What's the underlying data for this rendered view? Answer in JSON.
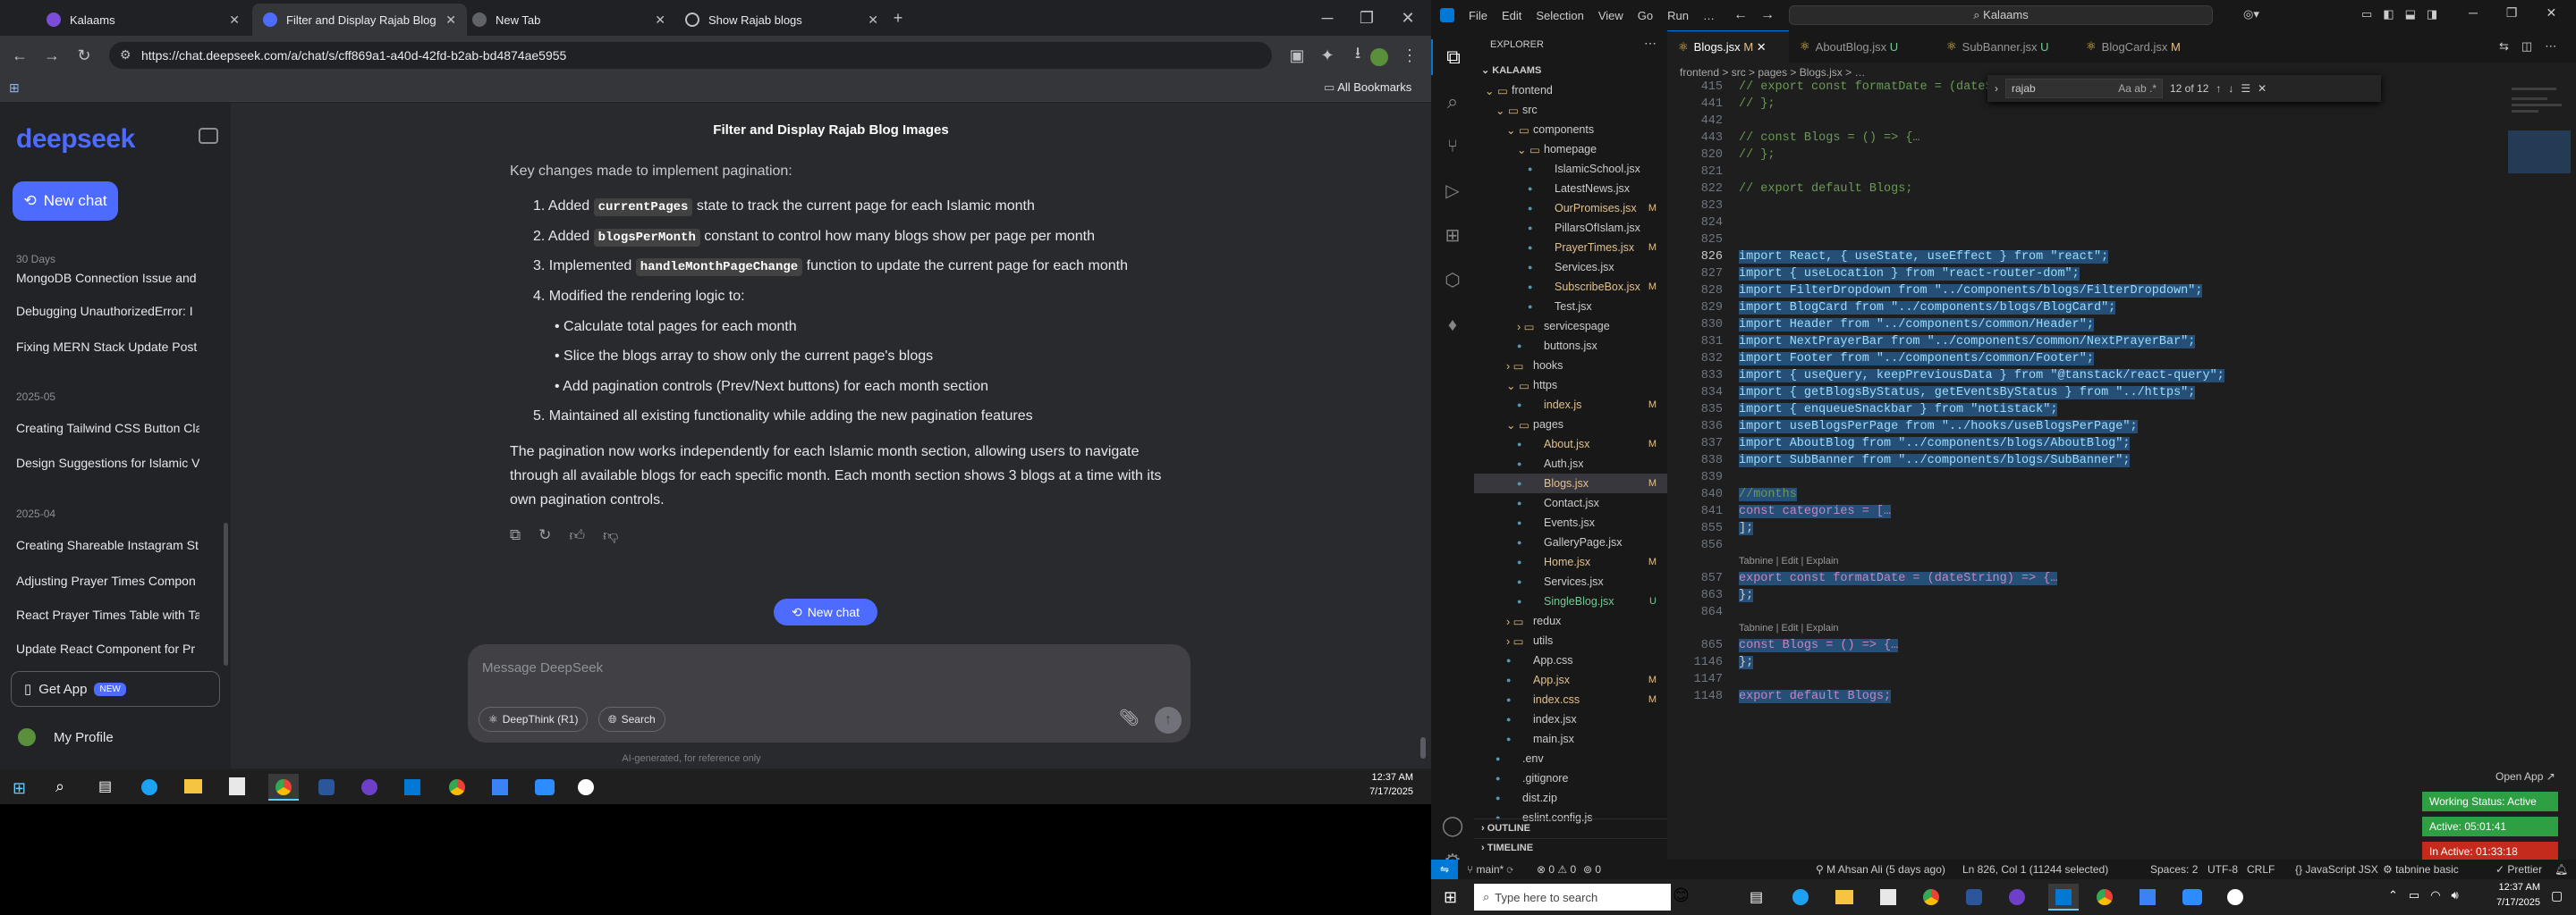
{
  "browser": {
    "tabs": [
      {
        "title": "Kalaams",
        "active": false
      },
      {
        "title": "Filter and Display Rajab Blog Im",
        "active": true
      },
      {
        "title": "New Tab",
        "active": false
      },
      {
        "title": "Show Rajab blogs",
        "active": false
      }
    ],
    "url": "https://chat.deepseek.com/a/chat/s/cff869a1-a40d-42fd-b2ab-bd4874ae5955",
    "all_bookmarks": "All Bookmarks"
  },
  "deepseek": {
    "logo": "deepseek",
    "new_chat": "New chat",
    "history_groups": [
      {
        "label": "30 Days",
        "items": [
          "MongoDB Connection Issue and",
          "Debugging UnauthorizedError: I",
          "Fixing MERN Stack Update Post I"
        ]
      },
      {
        "label": "2025-05",
        "items": [
          "Creating Tailwind CSS Button Cla",
          "Design Suggestions for Islamic V"
        ]
      },
      {
        "label": "2025-04",
        "items": [
          "Creating Shareable Instagram St",
          "Adjusting Prayer Times Compon",
          "React Prayer Times Table with Ta",
          "Update React Component for Pr"
        ]
      }
    ],
    "get_app": "Get App",
    "new_badge": "NEW",
    "profile": "My Profile",
    "chat_title": "Filter and Display Rajab Blog Images",
    "intro": "Key changes made to implement pagination:",
    "list": {
      "i1_num": "1.",
      "i1_pre": "Added ",
      "i1_code": "currentPages",
      "i1_post": " state to track the current page for each Islamic month",
      "i2_num": "2.",
      "i2_pre": "Added ",
      "i2_code": "blogsPerMonth",
      "i2_post": " constant to control how many blogs show per page per month",
      "i3_num": "3.",
      "i3_pre": "Implemented ",
      "i3_code": "handleMonthPageChange",
      "i3_post": " function to update the current page for each month",
      "i4_num": "4.",
      "i4": "Modified the rendering logic to:",
      "sub1": "Calculate total pages for each month",
      "sub2": "Slice the blogs array to show only the current page's blogs",
      "sub3": "Add pagination controls (Prev/Next buttons) for each month section",
      "i5_num": "5.",
      "i5": "Maintained all existing functionality while adding the new pagination features"
    },
    "para1": "The pagination now works independently for each Islamic month section, allowing users to navigate",
    "para2": "through all available blogs for each specific month. Each month section shows 3 blogs at a time with its",
    "para3": "own pagination controls.",
    "new_chat_pill": "New chat",
    "input_placeholder": "Message DeepSeek",
    "deepthink": "DeepThink (R1)",
    "search": "Search",
    "footer": "AI-generated, for reference only"
  },
  "taskbar_left": {
    "time": "12:37 AM",
    "date": "7/17/2025"
  },
  "vscode": {
    "menu": [
      "File",
      "Edit",
      "Selection",
      "View",
      "Go",
      "Run",
      "…"
    ],
    "search_title": "Kalaams",
    "explorer_title": "EXPLORER",
    "root": "KALAAMS",
    "tree": [
      {
        "name": "frontend",
        "level": 1,
        "type": "folder-open",
        "status": ""
      },
      {
        "name": "src",
        "level": 2,
        "type": "folder-open",
        "status": ""
      },
      {
        "name": "components",
        "level": 3,
        "type": "folder-open",
        "status": ""
      },
      {
        "name": "homepage",
        "level": 4,
        "type": "folder-open",
        "status": ""
      },
      {
        "name": "IslamicSchool.jsx",
        "level": 5,
        "type": "file",
        "status": ""
      },
      {
        "name": "LatestNews.jsx",
        "level": 5,
        "type": "file",
        "status": ""
      },
      {
        "name": "OurPromises.jsx",
        "level": 5,
        "type": "file",
        "status": "M"
      },
      {
        "name": "PillarsOfIslam.jsx",
        "level": 5,
        "type": "file",
        "status": ""
      },
      {
        "name": "PrayerTimes.jsx",
        "level": 5,
        "type": "file",
        "status": "M"
      },
      {
        "name": "Services.jsx",
        "level": 5,
        "type": "file",
        "status": ""
      },
      {
        "name": "SubscribeBox.jsx",
        "level": 5,
        "type": "file",
        "status": "M"
      },
      {
        "name": "Test.jsx",
        "level": 5,
        "type": "file",
        "status": ""
      },
      {
        "name": "servicespage",
        "level": 4,
        "type": "folder",
        "status": ""
      },
      {
        "name": "buttons.jsx",
        "level": 4,
        "type": "file",
        "status": ""
      },
      {
        "name": "hooks",
        "level": 3,
        "type": "folder",
        "status": ""
      },
      {
        "name": "https",
        "level": 3,
        "type": "folder-open",
        "status": ""
      },
      {
        "name": "index.js",
        "level": 4,
        "type": "file",
        "status": "M"
      },
      {
        "name": "pages",
        "level": 3,
        "type": "folder-open",
        "status": ""
      },
      {
        "name": "About.jsx",
        "level": 4,
        "type": "file",
        "status": "M"
      },
      {
        "name": "Auth.jsx",
        "level": 4,
        "type": "file",
        "status": ""
      },
      {
        "name": "Blogs.jsx",
        "level": 4,
        "type": "file",
        "status": "M"
      },
      {
        "name": "Contact.jsx",
        "level": 4,
        "type": "file",
        "status": ""
      },
      {
        "name": "Events.jsx",
        "level": 4,
        "type": "file",
        "status": ""
      },
      {
        "name": "GalleryPage.jsx",
        "level": 4,
        "type": "file",
        "status": ""
      },
      {
        "name": "Home.jsx",
        "level": 4,
        "type": "file",
        "status": "M"
      },
      {
        "name": "Services.jsx",
        "level": 4,
        "type": "file",
        "status": ""
      },
      {
        "name": "SingleBlog.jsx",
        "level": 4,
        "type": "file",
        "status": "U"
      },
      {
        "name": "redux",
        "level": 3,
        "type": "folder",
        "status": ""
      },
      {
        "name": "utils",
        "level": 3,
        "type": "folder",
        "status": ""
      },
      {
        "name": "App.css",
        "level": 3,
        "type": "file",
        "status": ""
      },
      {
        "name": "App.jsx",
        "level": 3,
        "type": "file",
        "status": "M"
      },
      {
        "name": "index.css",
        "level": 3,
        "type": "file",
        "status": "M"
      },
      {
        "name": "index.jsx",
        "level": 3,
        "type": "file",
        "status": ""
      },
      {
        "name": "main.jsx",
        "level": 3,
        "type": "file",
        "status": ""
      },
      {
        "name": ".env",
        "level": 2,
        "type": "file",
        "status": ""
      },
      {
        "name": ".gitignore",
        "level": 2,
        "type": "file",
        "status": ""
      },
      {
        "name": "dist.zip",
        "level": 2,
        "type": "file",
        "status": ""
      },
      {
        "name": "eslint.config.js",
        "level": 2,
        "type": "file",
        "status": ""
      }
    ],
    "outline": "OUTLINE",
    "timeline": "TIMELINE",
    "editor_tabs": [
      {
        "label": "Blogs.jsx",
        "status": "M",
        "active": true
      },
      {
        "label": "AboutBlog.jsx",
        "status": "U",
        "active": false
      },
      {
        "label": "SubBanner.jsx",
        "status": "U",
        "active": false
      },
      {
        "label": "BlogCard.jsx",
        "status": "M",
        "active": false
      }
    ],
    "breadcrumb": "frontend > src > pages > Blogs.jsx > …",
    "find_query": "rajab",
    "find_count": "12 of 12",
    "code_lines": [
      {
        "n": "415",
        "t": "// export const formatDate = (dateString) => {…",
        "c": "cm",
        "sel": false
      },
      {
        "n": "441",
        "t": "// };",
        "c": "cm",
        "sel": false
      },
      {
        "n": "442",
        "t": "",
        "c": "",
        "sel": false
      },
      {
        "n": "443",
        "t": "// const Blogs = () => {…",
        "c": "cm",
        "sel": false
      },
      {
        "n": "820",
        "t": "// };",
        "c": "cm",
        "sel": false
      },
      {
        "n": "821",
        "t": "",
        "c": "",
        "sel": false
      },
      {
        "n": "822",
        "t": "// export default Blogs;",
        "c": "cm",
        "sel": false
      },
      {
        "n": "823",
        "t": "",
        "c": "",
        "sel": false
      },
      {
        "n": "824",
        "t": "",
        "c": "",
        "sel": false
      },
      {
        "n": "825",
        "t": "",
        "c": "",
        "sel": false
      },
      {
        "n": "826",
        "t": "import React, { useState, useEffect } from \"react\";",
        "c": "imp",
        "sel": true
      },
      {
        "n": "827",
        "t": "import { useLocation } from \"react-router-dom\";",
        "c": "imp",
        "sel": true
      },
      {
        "n": "828",
        "t": "import FilterDropdown from \"../components/blogs/FilterDropdown\";",
        "c": "imp",
        "sel": true
      },
      {
        "n": "829",
        "t": "import BlogCard from \"../components/blogs/BlogCard\";",
        "c": "imp",
        "sel": true
      },
      {
        "n": "830",
        "t": "import Header from \"../components/common/Header\";",
        "c": "imp",
        "sel": true
      },
      {
        "n": "831",
        "t": "import NextPrayerBar from \"../components/common/NextPrayerBar\";",
        "c": "imp",
        "sel": true
      },
      {
        "n": "832",
        "t": "import Footer from \"../components/common/Footer\";",
        "c": "imp",
        "sel": true
      },
      {
        "n": "833",
        "t": "import { useQuery, keepPreviousData } from \"@tanstack/react-query\";",
        "c": "imp",
        "sel": true
      },
      {
        "n": "834",
        "t": "import { getBlogsByStatus, getEventsByStatus } from \"../https\";",
        "c": "imp",
        "sel": true
      },
      {
        "n": "835",
        "t": "import { enqueueSnackbar } from \"notistack\";",
        "c": "imp",
        "sel": true
      },
      {
        "n": "836",
        "t": "import useBlogsPerPage from \"../hooks/useBlogsPerPage\";",
        "c": "imp",
        "sel": true
      },
      {
        "n": "837",
        "t": "import AboutBlog from \"../components/blogs/AboutBlog\";",
        "c": "imp",
        "sel": true
      },
      {
        "n": "838",
        "t": "import SubBanner from \"../components/blogs/SubBanner\";",
        "c": "imp",
        "sel": true
      },
      {
        "n": "839",
        "t": "",
        "c": "",
        "sel": true
      },
      {
        "n": "840",
        "t": "//months",
        "c": "cm",
        "sel": true
      },
      {
        "n": "841",
        "t": "const categories = […",
        "c": "decl",
        "sel": true
      },
      {
        "n": "855",
        "t": "];",
        "c": "",
        "sel": true
      },
      {
        "n": "856",
        "t": "",
        "c": "",
        "sel": true
      },
      {
        "n": "857",
        "t": "export const formatDate = (dateString) => {…",
        "c": "decl",
        "sel": true
      },
      {
        "n": "863",
        "t": "};",
        "c": "",
        "sel": true
      },
      {
        "n": "864",
        "t": "",
        "c": "",
        "sel": true
      },
      {
        "n": "865",
        "t": "const Blogs = () => {…",
        "c": "decl",
        "sel": true
      },
      {
        "n": "1146",
        "t": "};",
        "c": "",
        "sel": true
      },
      {
        "n": "1147",
        "t": "",
        "c": "",
        "sel": true
      },
      {
        "n": "1148",
        "t": "export default Blogs;",
        "c": "decl",
        "sel": true
      }
    ],
    "tabnine_hint": "Tabnine | Edit | Explain",
    "open_app": "Open App ↗",
    "working_status": "Working Status: Active",
    "active_time": "Active: 05:01:41",
    "inactive_time": "In Active: 01:33:18",
    "status": {
      "branch": "main*",
      "problems": "⊗ 0 ⚠ 0",
      "info": "0",
      "author": "M Ahsan Ali (5 days ago)",
      "position": "Ln 826, Col 1 (11244 selected)",
      "spaces": "Spaces: 2",
      "encoding": "UTF-8",
      "eol": "CRLF",
      "language": "{} JavaScript JSX",
      "tabnine": "tabnine basic",
      "prettier": "✓ Prettier"
    }
  },
  "taskbar_right": {
    "search_placeholder": "Type here to search",
    "time": "12:37 AM",
    "date": "7/17/2025"
  },
  "colors": {
    "deepseek_blue": "#4d6bfe",
    "vscode_blue": "#0078d4",
    "selection": "#264f78",
    "status_green": "#2ea043",
    "status_red": "#c42b1c"
  }
}
